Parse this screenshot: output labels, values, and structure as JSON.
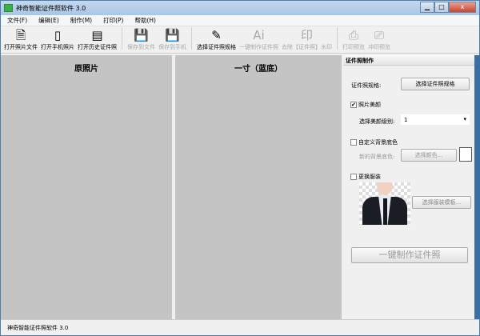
{
  "window": {
    "title": "神奇智能证件照软件 3.0",
    "min": "▁",
    "max": "□",
    "close": "x"
  },
  "menu": [
    "文件(F)",
    "编辑(E)",
    "制作(M)",
    "打印(P)",
    "帮助(H)"
  ],
  "toolbar": [
    {
      "label": "打开照片文件",
      "icon": "🗎",
      "enabled": true
    },
    {
      "label": "打开手机照片",
      "icon": "▯",
      "enabled": true
    },
    {
      "label": "打开历史证件照",
      "icon": "▤",
      "enabled": true
    },
    {
      "label": "保存到文件",
      "icon": "💾",
      "enabled": false
    },
    {
      "label": "保存到手机",
      "icon": "💾",
      "enabled": false
    },
    {
      "label": "选择证件照规格",
      "icon": "✎",
      "enabled": true
    },
    {
      "label": "一键制作证件照",
      "icon": "Ai",
      "enabled": false
    },
    {
      "label": "去除【证件照】水印",
      "icon": "印",
      "enabled": false
    },
    {
      "label": "打印预览",
      "icon": "⎙",
      "enabled": false
    },
    {
      "label": "冲印预览",
      "icon": "⎚",
      "enabled": false
    }
  ],
  "panels": {
    "original": "原照片",
    "result": "一寸（蓝底）"
  },
  "side": {
    "header": "证件照制作",
    "spec_label": "证件照规格:",
    "spec_button": "选择证件照规格",
    "beauty_check": "照片美颜",
    "beauty_checked": true,
    "beauty_level_label": "选择美颜级别:",
    "beauty_level": "1",
    "custom_bg_check": "自定义背景底色",
    "custom_bg_checked": false,
    "new_bg_label": "新的背景底色:",
    "color_button": "选择颜色...",
    "swatch_color": "#ffffff",
    "clothes_check": "更换服装",
    "clothes_checked": false,
    "clothes_button": "选择服装模板...",
    "make_button": "一键制作证件照"
  },
  "status": "神奇智能证件照软件 3.0"
}
